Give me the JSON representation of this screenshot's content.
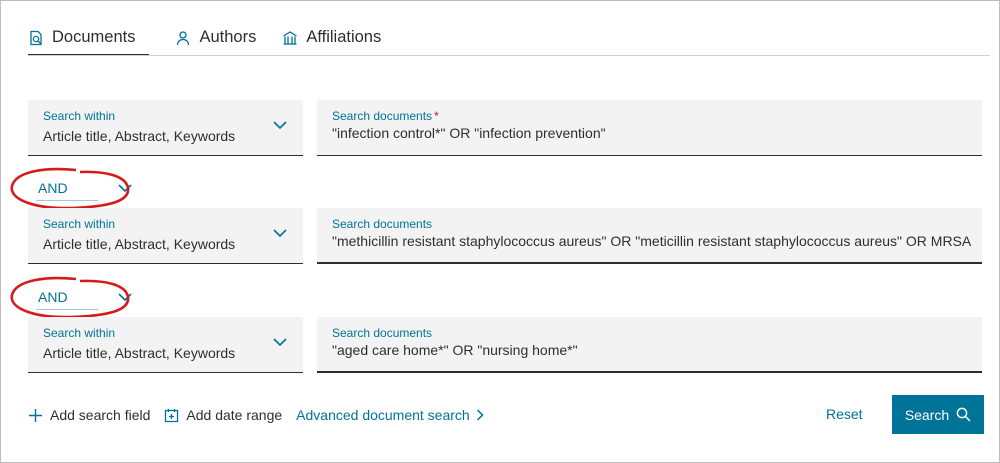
{
  "tabs": [
    {
      "label": "Documents",
      "icon": "document-search-icon",
      "active": true
    },
    {
      "label": "Authors",
      "icon": "person-icon",
      "active": false
    },
    {
      "label": "Affiliations",
      "icon": "building-icon",
      "active": false
    }
  ],
  "rows": [
    {
      "within_label": "Search within",
      "within_value": "Article title, Abstract, Keywords",
      "docs_label": "Search documents",
      "required_mark": "*",
      "query": "\"infection control*\" OR \"infection prevention\""
    },
    {
      "within_label": "Search within",
      "within_value": "Article title, Abstract, Keywords",
      "docs_label": "Search documents",
      "query": "\"methicillin resistant staphylococcus aureus\" OR \"meticillin resistant staphylococcus aureus\" OR MRSA"
    },
    {
      "within_label": "Search within",
      "within_value": "Article title, Abstract, Keywords",
      "docs_label": "Search documents",
      "query": "\"aged care home*\" OR \"nursing home*\""
    }
  ],
  "operators": [
    "AND",
    "AND"
  ],
  "actions": {
    "add_search_field": "Add search field",
    "add_date_range": "Add date range",
    "advanced": "Advanced document search",
    "reset": "Reset",
    "search": "Search"
  },
  "colors": {
    "accent": "#007398",
    "highlight_circle": "#d61a1a",
    "field_bg": "#f3f3f3"
  }
}
